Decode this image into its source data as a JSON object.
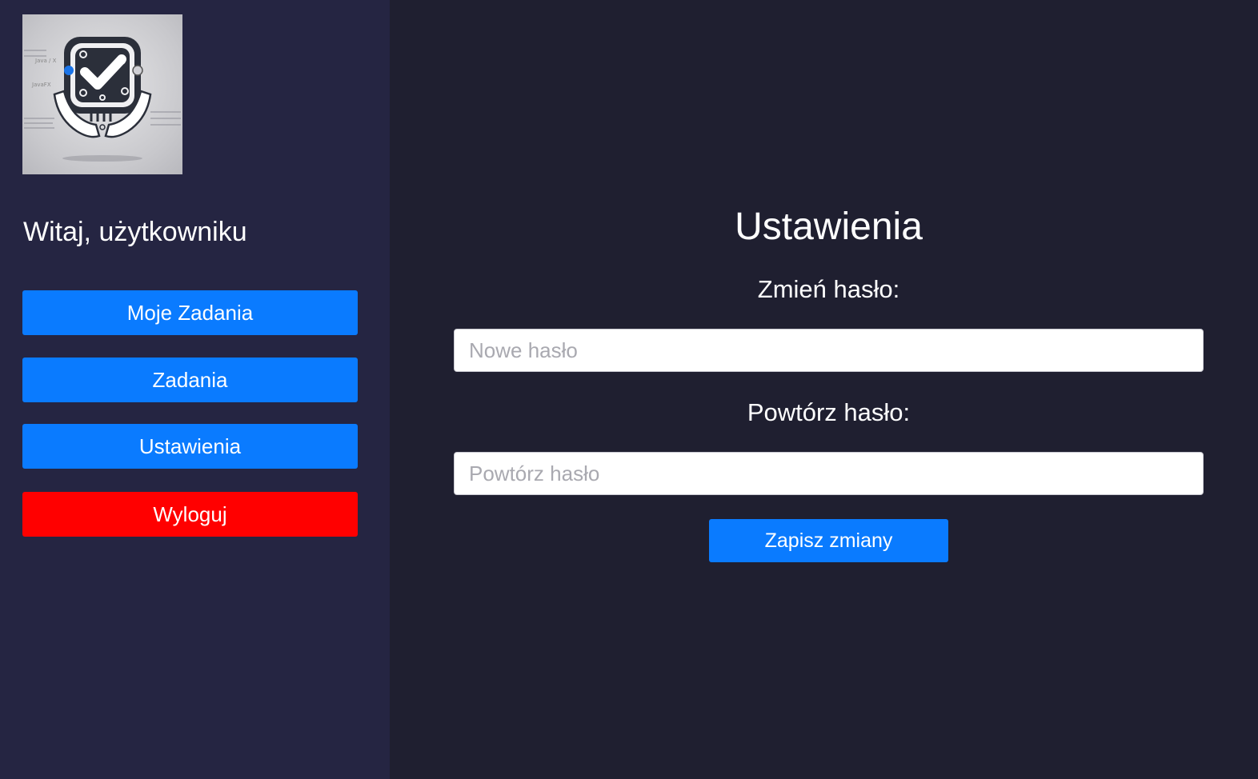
{
  "sidebar": {
    "logo_icon": "circuit-checkmark-hands-logo",
    "logo_texts": [
      "Java / X",
      "JavaFX"
    ],
    "welcome": "Witaj, użytkowniku",
    "nav": {
      "my_tasks": "Moje Zadania",
      "tasks": "Zadania",
      "settings": "Ustawienia",
      "logout": "Wyloguj"
    }
  },
  "main": {
    "title": "Ustawienia",
    "change_password_label": "Zmień hasło:",
    "new_password_placeholder": "Nowe hasło",
    "repeat_password_label": "Powtórz hasło:",
    "repeat_password_placeholder": "Powtórz hasło",
    "save_label": "Zapisz zmiany"
  },
  "colors": {
    "sidebar_bg": "#252542",
    "main_bg": "#1f1f30",
    "primary": "#0a7bff",
    "danger": "#ff0000"
  }
}
